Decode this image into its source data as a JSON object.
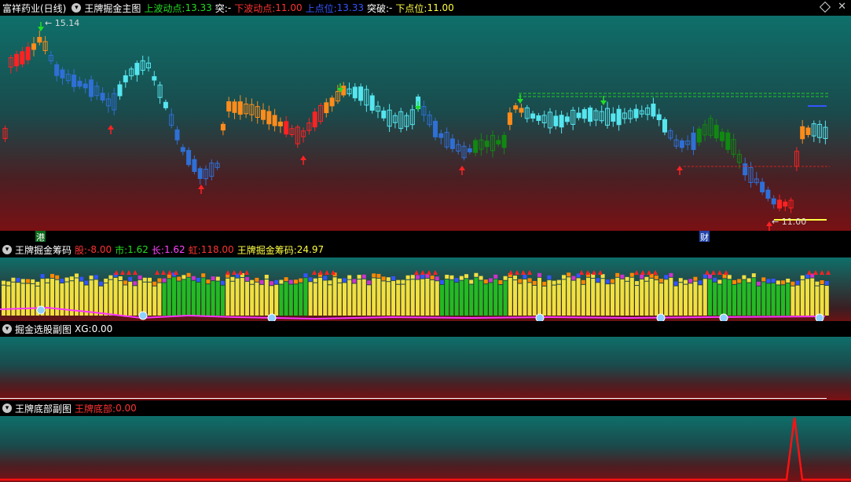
{
  "main": {
    "stock_name": "富祥药业(日线)",
    "indicator_name": "王牌掘金主图",
    "up_wave_label": "上波动点:",
    "up_wave_value": "13.33",
    "break1_label": "突:",
    "break1_value": "-",
    "down_wave_label": "下波动点:",
    "down_wave_value": "11.00",
    "upper_label": "上点位:",
    "upper_value": "13.33",
    "break2_label": "突破:",
    "break2_value": "-",
    "lower_label": "下点位:",
    "lower_value": "11.00",
    "high_marker": "15.14",
    "low_marker": "11.00",
    "tag_left": "港",
    "tag_right": "财"
  },
  "chips": {
    "title": "王牌掘金筹码",
    "gu_label": "股:",
    "gu_value": "-8.00",
    "shi_label": "市:",
    "shi_value": "1.62",
    "chang_label": "长:",
    "chang_value": "1.62",
    "hong_label": "虹:",
    "hong_value": "118.00",
    "chip_label": "王牌掘金筹码:",
    "chip_value": "24.97"
  },
  "xg": {
    "title": "掘金选股副图",
    "label": "XG:",
    "value": "0.00"
  },
  "bottom": {
    "title": "王牌底部副图",
    "label": "王牌底部:",
    "value": "0.00"
  },
  "colors": {
    "up_wave": "#22dd22",
    "down_wave": "#ff3333",
    "upper": "#3355ff",
    "lower": "#ffff44",
    "cyan": "#55e6f0",
    "blue": "#2f6fd6",
    "orange": "#ff8c1a",
    "red": "#ff2222",
    "green": "#118811",
    "yellow": "#f0e040"
  }
}
